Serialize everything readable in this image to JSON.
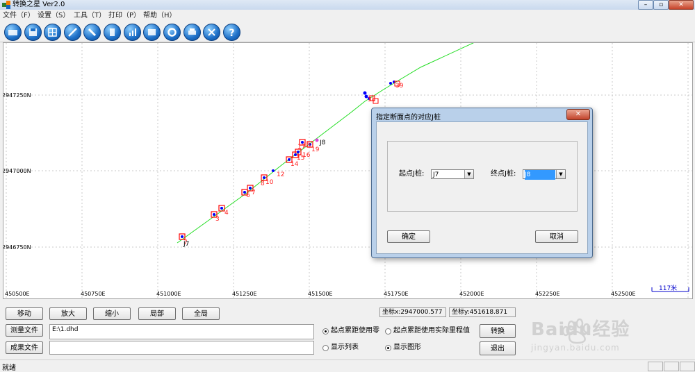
{
  "window": {
    "title": "转换之星 Ver2.0"
  },
  "menu": [
    {
      "label": "文件（F）"
    },
    {
      "label": "设置（S）"
    },
    {
      "label": "工具（T）"
    },
    {
      "label": "打印（P）"
    },
    {
      "label": "帮助（H）"
    }
  ],
  "toolbar_icons": [
    "folder-open-icon",
    "save-icon",
    "grid-table-icon",
    "edit-icon",
    "tool-icon",
    "book-icon",
    "chart-icon",
    "image-icon",
    "gear-icon",
    "printer-icon",
    "close-icon",
    "help-icon"
  ],
  "plot": {
    "x_ticks": [
      "450500E",
      "450750E",
      "451000E",
      "451250E",
      "451500E",
      "451750E",
      "452000E",
      "452250E",
      "452500E"
    ],
    "y_ticks": [
      "2947250N",
      "2947000N",
      "2946750N"
    ],
    "scale_label": "117米",
    "point_labels": [
      "7",
      "3",
      "4",
      "6",
      "7",
      "8",
      "10",
      "12",
      "13",
      "14",
      "15",
      "16",
      "J8",
      "19",
      "38",
      "39",
      "J7",
      "17"
    ]
  },
  "controls": {
    "move": "移动",
    "zoom_in": "放大",
    "zoom_out": "缩小",
    "partial": "局部",
    "full": "全局",
    "coord_x": "坐标x:2947000.577",
    "coord_y": "坐标y:451618.871",
    "survey_file_btn": "测量文件",
    "survey_file_path": "E:\\1.dhd",
    "result_file_btn": "成果文件",
    "result_file_path": "",
    "radio_zero": "起点累距使用零",
    "radio_actual": "起点累距使用实际里程值",
    "radio_list": "显示列表",
    "radio_graph": "显示图形",
    "convert": "转换",
    "exit": "退出"
  },
  "status": {
    "text": "就绪"
  },
  "dialog": {
    "title": "指定断面点的对应J桩",
    "close": "✕",
    "start_label": "起点J桩:",
    "start_value": "J7",
    "end_label": "终点J桩:",
    "end_value": "J8",
    "ok": "确定",
    "cancel": "取消"
  },
  "watermark": {
    "brand": "Baidu经验",
    "url": "jingyan.baidu.com"
  },
  "colors": {
    "accent": "#3399ff",
    "line": "#22dd22",
    "marker": "#ff0000",
    "point": "#0000ff"
  }
}
